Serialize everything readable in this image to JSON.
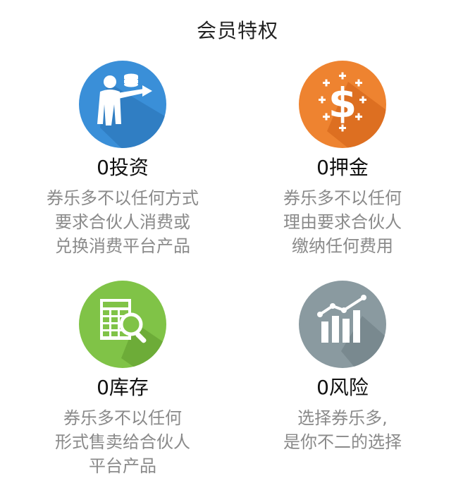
{
  "page": {
    "title": "会员特权"
  },
  "colors": {
    "blue": "#3a8fd8",
    "orange": "#ee8330",
    "green": "#80c347",
    "gray": "#8a9aa0"
  },
  "features": [
    {
      "icon": "presenter-coins-icon",
      "title": "0投资",
      "desc": [
        "券乐多不以任何方式",
        "要求合伙人消费或",
        "兑换消费平台产品"
      ]
    },
    {
      "icon": "dollar-sparkle-icon",
      "title": "0押金",
      "desc": [
        "券乐多不以任何",
        "理由要求合伙人",
        "缴纳任何费用"
      ]
    },
    {
      "icon": "spreadsheet-magnifier-icon",
      "title": "0库存",
      "desc": [
        "券乐多不以任何",
        "形式售卖给合伙人",
        "平台产品"
      ]
    },
    {
      "icon": "rising-bar-chart-icon",
      "title": "0风险",
      "desc": [
        "选择券乐多,",
        "是你不二的选择"
      ]
    }
  ]
}
